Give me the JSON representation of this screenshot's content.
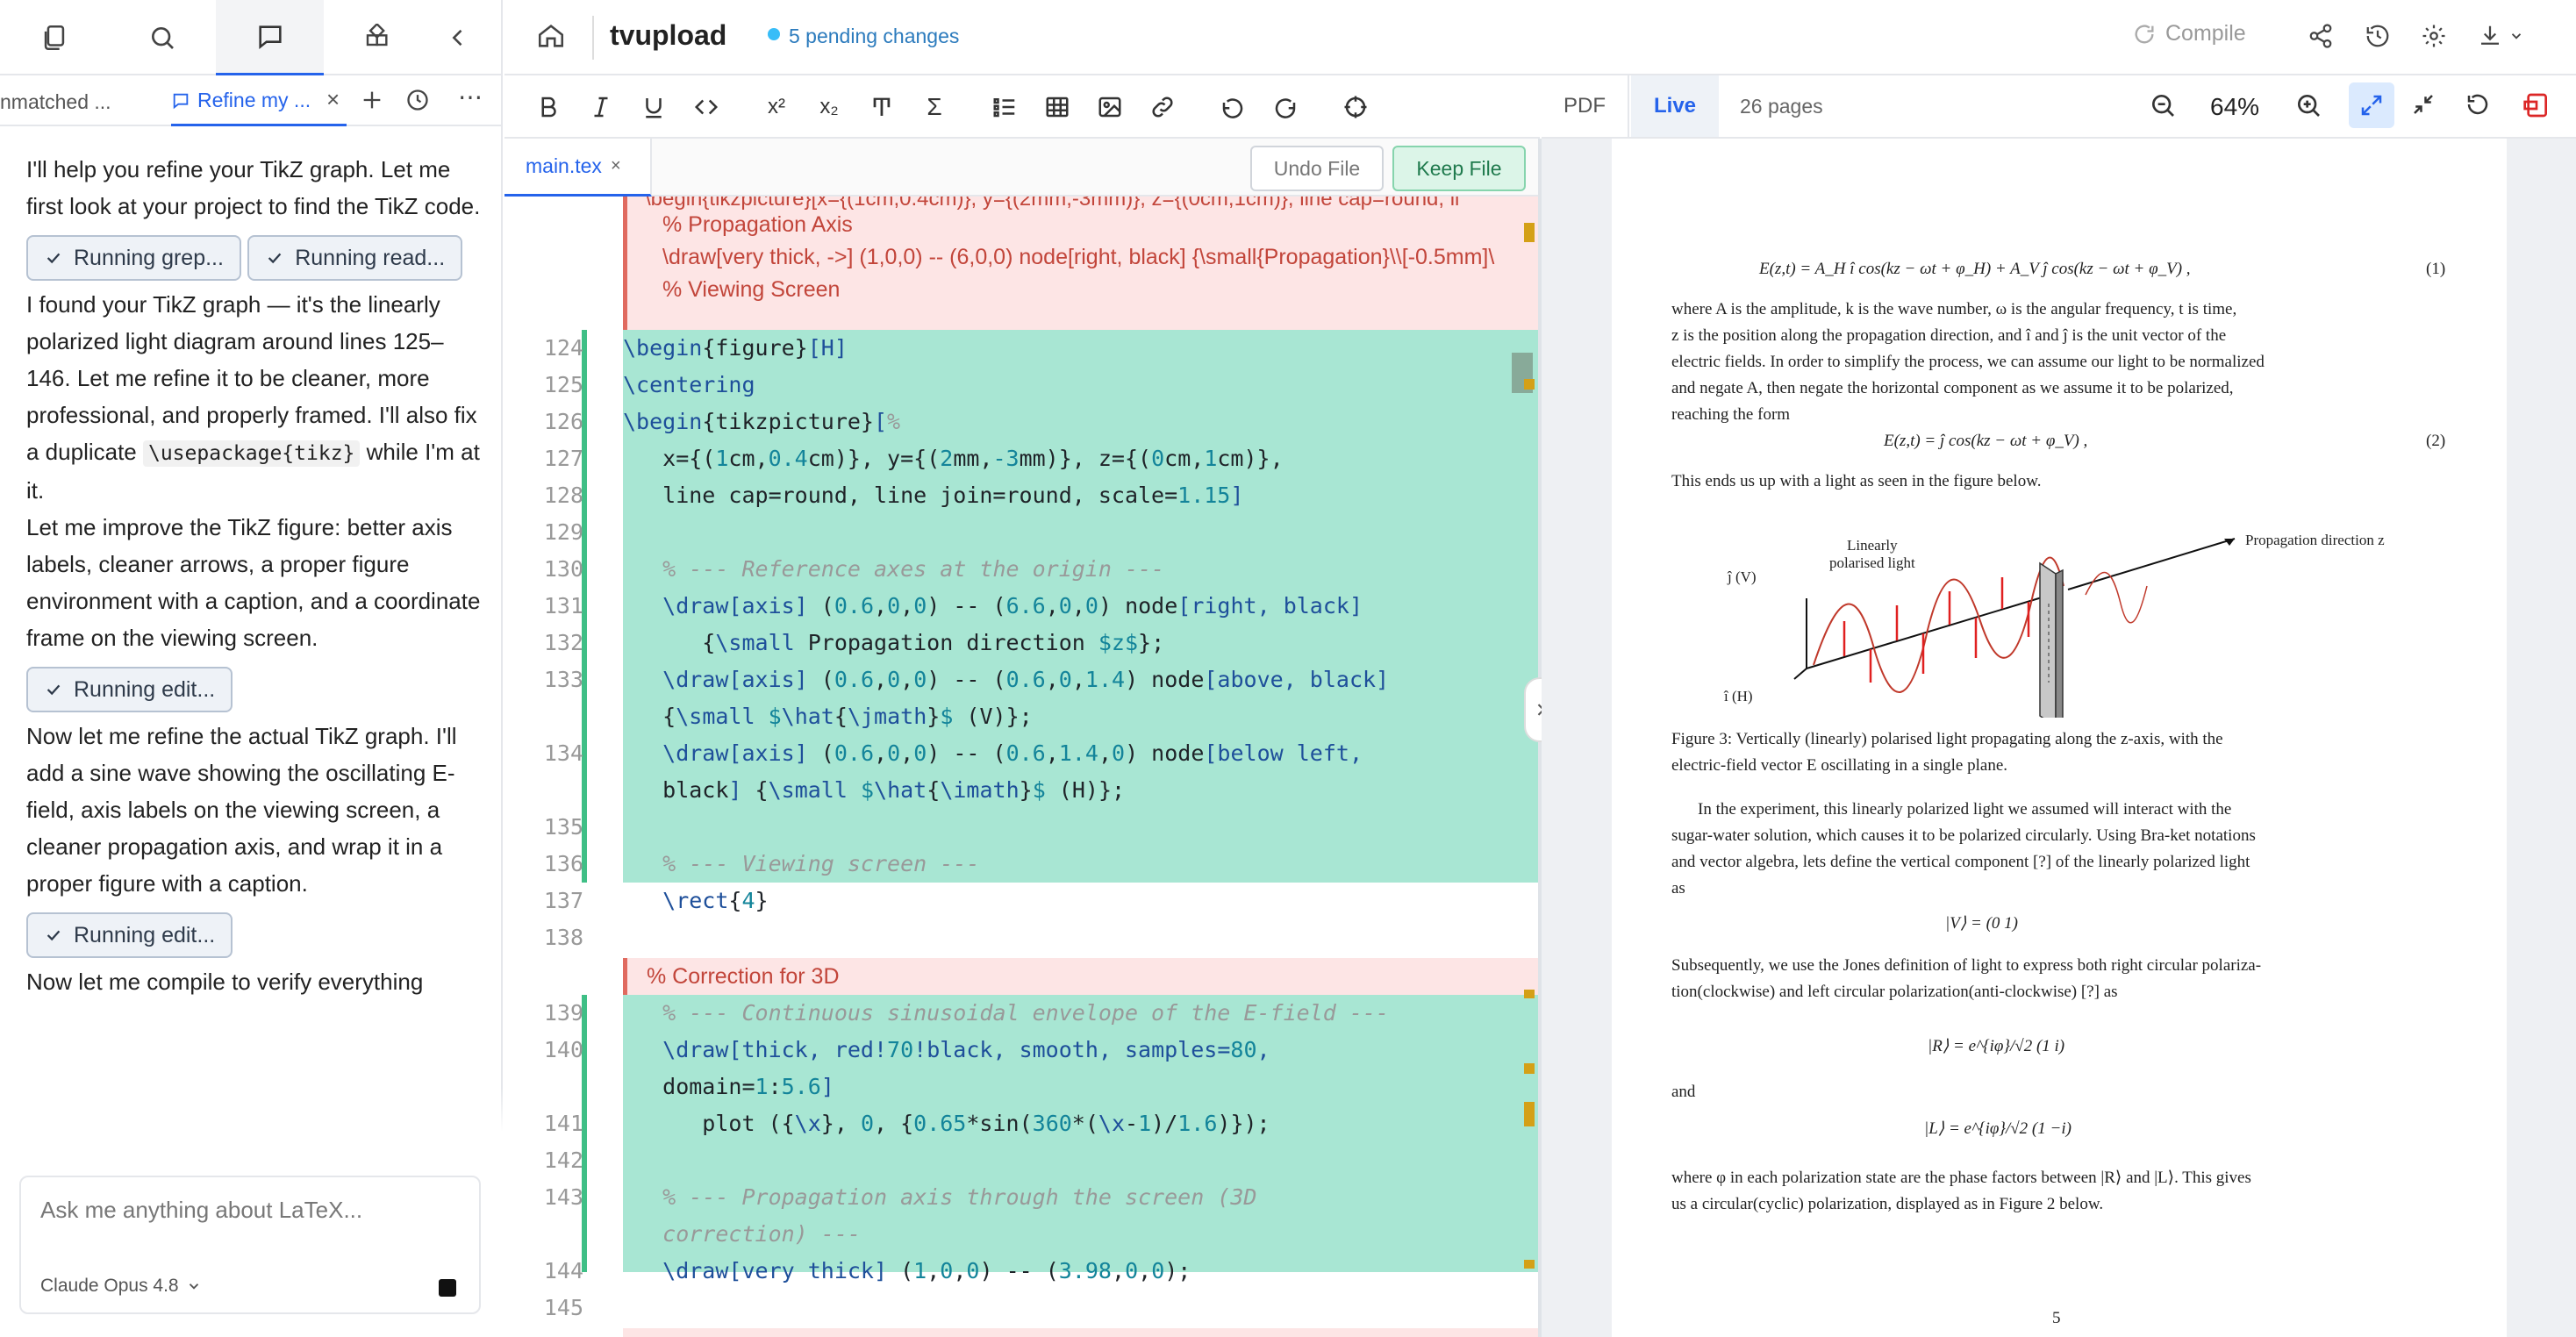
{
  "left_panel": {
    "tabs": [
      {
        "label": "nmatched ..."
      },
      {
        "label": "Refine my ..."
      }
    ],
    "chat": {
      "p1": "I'll help you refine your TikZ graph. Let me first look at your project to find the TikZ code.",
      "chip1": "Running grep...",
      "chip2": "Running read...",
      "p2a": "I found your TikZ graph — it's the linearly polarized light diagram around lines 125–146. Let me refine it to be cleaner, more professional, and properly framed. I'll also fix a duplicate ",
      "p2code": "\\usepackage{tikz}",
      "p2b": " while I'm at it.",
      "p3": "Let me improve the TikZ figure: better axis labels, cleaner arrows, a proper figure environment with a caption, and a coordinate frame on the viewing screen.",
      "chip3": "Running edit...",
      "p4": "Now let me refine the actual TikZ graph. I'll add a sine wave showing the oscillating E-field, axis labels on the viewing screen, a cleaner propagation axis, and wrap it in a proper figure with a caption.",
      "chip4": "Running edit...",
      "p5": "Now let me compile to verify everything"
    },
    "input": {
      "placeholder": "Ask me anything about LaTeX...",
      "model": "Claude Opus 4.8"
    }
  },
  "header": {
    "project": "tvupload",
    "pending": "5 pending changes",
    "compile": "Compile"
  },
  "editor": {
    "file_tab": "main.tex",
    "undo_label": "Undo File",
    "keep_label": "Keep File",
    "deleted_top": [
      "\\begin{tikzpicture}[x={(1cm,0.4cm)}, y={(2mm,-3mm)}, z={(0cm,1cm)}, line cap=round, li",
      "% Propagation Axis",
      "\\draw[very thick, ->] (1,0,0) -- (6,0,0) node[right, black] {\\small{Propagation}\\\\[-0.5mm]\\",
      "% Viewing Screen"
    ],
    "deleted_mid": "% Correction for 3D"
  },
  "pdf": {
    "tab_pdf": "PDF",
    "tab_live": "Live",
    "pages": "26 pages",
    "zoom": "64%",
    "eq1": "E(z,t) = A_H î cos(kz − ωt + φ_H) + A_V ĵ cos(kz − ωt + φ_V) ,",
    "eq1n": "(1)",
    "para1": [
      "where A is the amplitude, k is the wave number, ω is the angular frequency, t is time,",
      "z is the position along the propagation direction, and î and ĵ is the unit vector of the",
      "electric fields. In order to simplify the process, we can assume our light to be normalized",
      "and negate A, then negate the horizontal component as we assume it to be polarized,",
      "reaching the form"
    ],
    "eq2": "E(z,t) = ĵ cos(kz − ωt + φ_V) ,",
    "eq2n": "(2)",
    "para2": "This ends us up with a light as seen in the figure below.",
    "fig_labels": {
      "lp": "Linearly",
      "lp2": "polarised light",
      "prop": "Propagation direction z",
      "jv": "ĵ (V)",
      "ih": "î (H)"
    },
    "caption": [
      "Figure 3:  Vertically (linearly) polarised light propagating along the z-axis, with the",
      "electric-field vector E oscillating in a single plane."
    ],
    "para3": [
      "In the experiment, this linearly polarized light we assumed will interact with the",
      "sugar-water solution, which causes it to be polarized circularly. Using Bra-ket notations",
      "and vector algebra, lets define the vertical component [?] of the linearly polarized light",
      "as"
    ],
    "eqV": "|V⟩ = (0 1)",
    "para4": [
      "Subsequently, we use the Jones definition of light to express both right circular polariza-",
      "tion(clockwise) and left circular polarization(anti-clockwise) [?] as"
    ],
    "eqR": "|R⟩ = e^{iφ}/√2 (1 i)",
    "and": "and",
    "eqL": "|L⟩ = e^{iφ}/√2 (1 −i)",
    "para5": [
      "where φ in each polarization state are the phase factors between |R⟩ and |L⟩. This gives",
      "us a circular(cyclic) polarization, displayed as in Figure 2 below."
    ],
    "pageno": "5"
  },
  "colors": {
    "accent": "#2563eb",
    "added": "#a8e6d3",
    "deleted": "#fde5e5",
    "keep": "#1f7a4d"
  }
}
